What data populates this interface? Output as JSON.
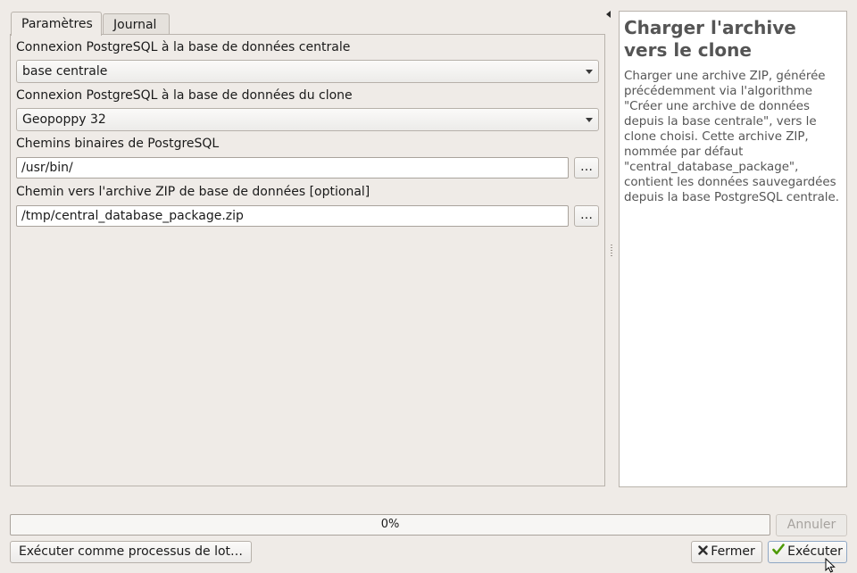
{
  "tabs": {
    "params": "Paramètres",
    "journal": "Journal"
  },
  "params": {
    "central_label": "Connexion PostgreSQL à la base de données centrale",
    "central_value": "base centrale",
    "clone_label": "Connexion PostgreSQL à la base de données du clone",
    "clone_value": "Geopoppy 32",
    "bin_label": "Chemins binaires de PostgreSQL",
    "bin_value": "/usr/bin/",
    "zip_label": "Chemin vers l'archive ZIP de base de données [optional]",
    "zip_value": "/tmp/central_database_package.zip",
    "browse": "…"
  },
  "help": {
    "title": "Charger l'archive vers le clone",
    "body": "Charger une archive ZIP, générée précédemment via l'algorithme \"Créer une archive de données depuis la base centrale\", vers le clone choisi. Cette archive ZIP, nommée par défaut \"central_database_package\", contient les données sauvegardées depuis la base PostgreSQL centrale."
  },
  "progress": {
    "text": "0%",
    "value": 0
  },
  "buttons": {
    "cancel": "Annuler",
    "batch": "Exécuter comme processus de lot…",
    "close": "Fermer",
    "run": "Exécuter"
  },
  "icons": {
    "close": "close-x-icon",
    "run": "checkmark-icon",
    "collapse": "collapse-arrow-icon",
    "cursor": "mouse-pointer-icon"
  },
  "colors": {
    "window_bg": "#efebe7",
    "help_text": "#555555",
    "check_green": "#4e9a06"
  }
}
